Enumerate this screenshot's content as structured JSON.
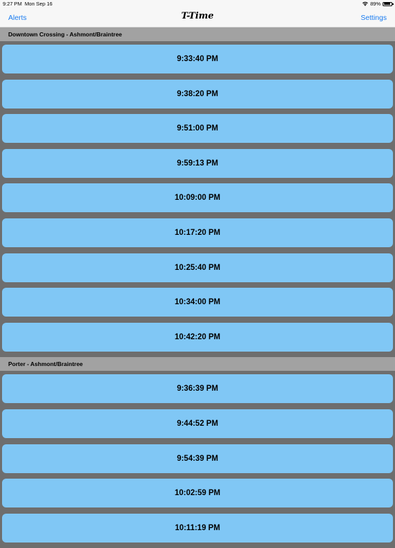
{
  "status_bar": {
    "time": "9:27 PM",
    "date": "Mon Sep 16",
    "battery": "89%",
    "battery_level": 0.89,
    "icons": [
      "wifi-icon",
      "battery-icon"
    ]
  },
  "nav": {
    "left_label": "Alerts",
    "title": "T-Time",
    "right_label": "Settings"
  },
  "colors": {
    "accent": "#1a7cf0",
    "row": "#80c7f5",
    "section_header": "#a2a2a2",
    "background": "#6e6e6e"
  },
  "sections": [
    {
      "title": "Downtown Crossing - Ashmont/Braintree",
      "times": [
        "9:33:40 PM",
        "9:38:20 PM",
        "9:51:00 PM",
        "9:59:13 PM",
        "10:09:00 PM",
        "10:17:20 PM",
        "10:25:40 PM",
        "10:34:00 PM",
        "10:42:20 PM"
      ]
    },
    {
      "title": "Porter - Ashmont/Braintree",
      "times": [
        "9:36:39 PM",
        "9:44:52 PM",
        "9:54:39 PM",
        "10:02:59 PM",
        "10:11:19 PM"
      ]
    }
  ]
}
